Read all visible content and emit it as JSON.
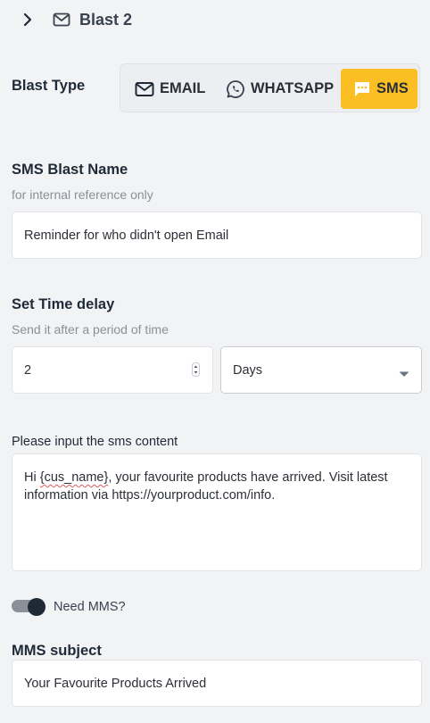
{
  "header": {
    "title": "Blast 2",
    "chevron_icon": "chevron-right-icon",
    "mail_icon": "mail-icon"
  },
  "blast_type": {
    "label": "Blast Type",
    "options": [
      {
        "label": "EMAIL",
        "icon": "mail-icon",
        "selected": false
      },
      {
        "label": "WHATSAPP",
        "icon": "whatsapp-icon",
        "selected": false
      },
      {
        "label": "SMS",
        "icon": "sms-chat-icon",
        "selected": true
      }
    ],
    "active_color": "#fbbf24"
  },
  "sms_name": {
    "label": "SMS Blast Name",
    "helper": "for internal reference only",
    "value": "Reminder for who didn't open Email"
  },
  "time_delay": {
    "label": "Set Time delay",
    "helper": "Send it after a period of time",
    "amount": "2",
    "unit": "Days"
  },
  "content": {
    "label": "Please input the sms content",
    "pre": "Hi ",
    "variable": "{cus_name}",
    "post": ", your favourite products have arrived. Visit latest information via https://yourproduct.com/info."
  },
  "mms": {
    "toggle_label": "Need MMS?",
    "enabled": true,
    "subject_label": "MMS subject",
    "subject_value": "Your Favourite Products Arrived"
  }
}
